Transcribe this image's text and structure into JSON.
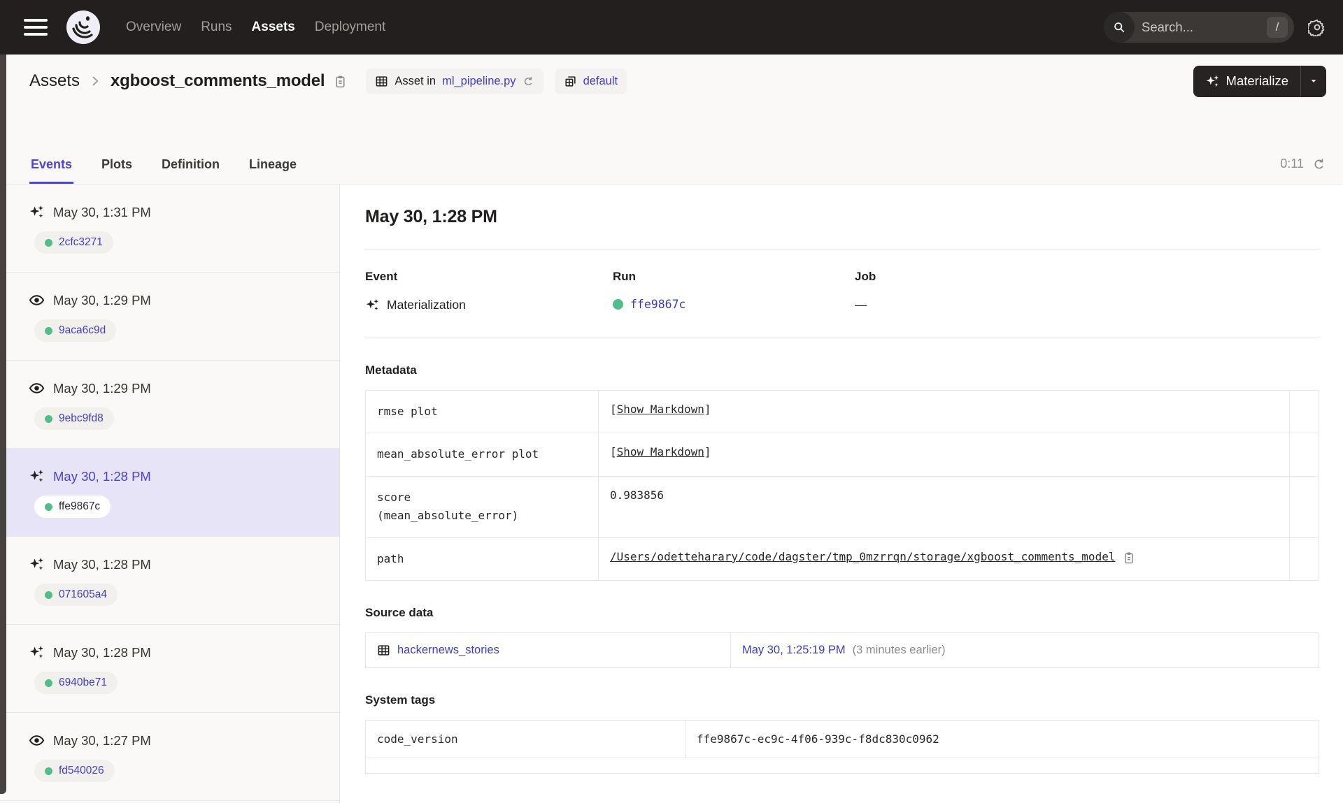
{
  "colors": {
    "header_bg": "#221F1E",
    "accent": "#4F43DD",
    "link": "#433DC4",
    "run_green": "#4FBE8A",
    "selected_row_bg": "#E7E4F8"
  },
  "nav": {
    "menu": [
      "Overview",
      "Runs",
      "Assets",
      "Deployment"
    ],
    "search_placeholder": "Search...",
    "shortcut_key": "/"
  },
  "header": {
    "breadcrumb_root": "Assets",
    "breadcrumb_current": "xgboost_comments_model",
    "asset_badge_prefix": "Asset in",
    "asset_badge_file": "ml_pipeline.py",
    "repo_badge": "default",
    "materialize_label": "Materialize"
  },
  "tabs": [
    "Events",
    "Plots",
    "Definition",
    "Lineage"
  ],
  "refresh_timer": "0:11",
  "sidebar": {
    "items": [
      {
        "type": "materialization",
        "time": "May 30, 1:31 PM",
        "run_id": "2cfc3271",
        "selected": false
      },
      {
        "type": "observation",
        "time": "May 30, 1:29 PM",
        "run_id": "9aca6c9d",
        "selected": false
      },
      {
        "type": "observation",
        "time": "May 30, 1:29 PM",
        "run_id": "9ebc9fd8",
        "selected": false
      },
      {
        "type": "materialization",
        "time": "May 30, 1:28 PM",
        "run_id": "ffe9867c",
        "selected": true
      },
      {
        "type": "materialization",
        "time": "May 30, 1:28 PM",
        "run_id": "071605a4",
        "selected": false
      },
      {
        "type": "materialization",
        "time": "May 30, 1:28 PM",
        "run_id": "6940be71",
        "selected": false
      },
      {
        "type": "observation",
        "time": "May 30, 1:27 PM",
        "run_id": "fd540026",
        "selected": false
      }
    ]
  },
  "detail": {
    "title": "May 30, 1:28 PM",
    "event_label": "Event",
    "event_value": "Materialization",
    "run_label": "Run",
    "run_value": "ffe9867c",
    "job_label": "Job",
    "job_value": "—",
    "punctuation": {
      "open": "[",
      "close": "]"
    },
    "metadata": {
      "heading": "Metadata",
      "rows": [
        {
          "key": "rmse plot",
          "value": "Show Markdown"
        },
        {
          "key": "mean_absolute_error plot",
          "value": "Show Markdown"
        },
        {
          "key": "score",
          "key_line2": "(mean_absolute_error)",
          "value": "0.983856"
        },
        {
          "key": "path",
          "value": "/Users/odetteharary/code/dagster/tmp_0mzrrqn/storage/xgboost_comments_model"
        }
      ]
    },
    "source_data": {
      "heading": "Source data",
      "asset_name": "hackernews_stories",
      "timestamp": "May 30, 1:25:19 PM",
      "relative_note": "(3 minutes earlier)"
    },
    "system_tags": {
      "heading": "System tags",
      "rows": [
        {
          "key": "code_version",
          "value": "ffe9867c-ec9c-4f06-939c-f8dc830c0962"
        }
      ]
    }
  }
}
